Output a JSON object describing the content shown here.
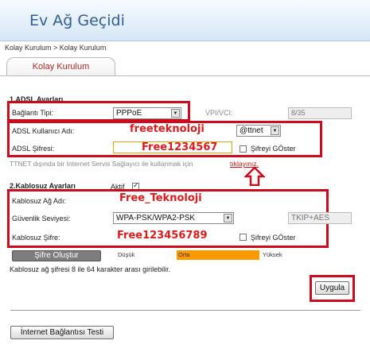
{
  "header": {
    "title": "Ev Ağ Geçidi"
  },
  "breadcrumb": "Kolay Kurulum > Kolay Kurulum",
  "tab": {
    "label": "Kolay Kurulum"
  },
  "adsl": {
    "section_title": "1.ADSL Ayarları",
    "connection_type_label": "Bağlantı Tipi:",
    "connection_type_value": "PPPoE",
    "vpi_label": "VPI/VCI:",
    "vpi_value": "8/35",
    "username_label": "ADSL Kullanıcı Adı:",
    "username_value": "freeteknoloji",
    "domain_value": "@ttnet",
    "password_label": "ADSL Şifresi:",
    "password_value": "Free1234567",
    "show_password_label": "Şifreyi GÖster",
    "isp_note": "TTNET dışında bir Internet Servis Sağlayıcı ile kullanmak için",
    "isp_link": "tıklayınız."
  },
  "wireless": {
    "section_title": "2.Kablosuz Ayarları",
    "active_label": "Aktif",
    "active_checked": true,
    "ssid_label": "Kablosuz Ağ Adı:",
    "ssid_value": "Free_Teknoloji",
    "security_label": "Güvenlik Seviyesi:",
    "security_value": "WPA-PSK/WPA2-PSK",
    "cipher_value": "TKIP+AES",
    "password_label": "Kablosuz Şifre:",
    "password_value": "Free123456789",
    "show_password_label": "Şifreyi GÖster",
    "generate_button": "Şifre Oluştur",
    "strength_low": "Düşük",
    "strength_mid": "Orta",
    "strength_high": "Yüksek",
    "hint": "Kablosuz ağ şifresi 8 ile 64 karakter arası girilebilir."
  },
  "actions": {
    "apply_button": "Uygula",
    "test_button": "İnternet Bağlantısı Testi"
  },
  "colors": {
    "annotation_red": "#cc0b1d",
    "header_text": "#335e95",
    "strength_mid": "#ff9900"
  }
}
